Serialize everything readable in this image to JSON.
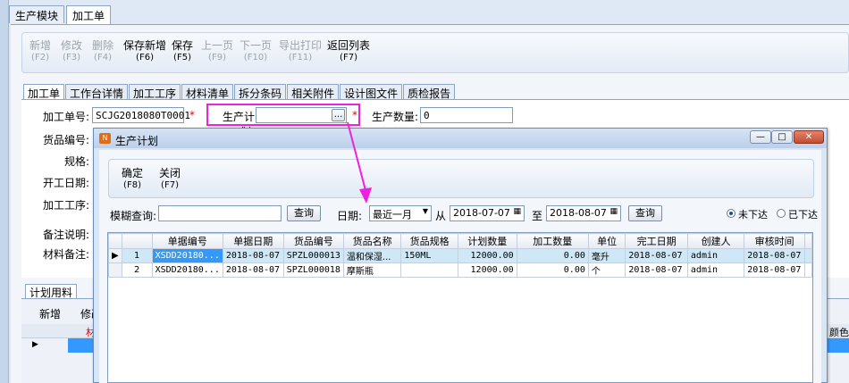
{
  "top_tabs": [
    "生产模块",
    "加工单"
  ],
  "toolbar": {
    "buttons": [
      {
        "label": "新增",
        "key": "(F2)"
      },
      {
        "label": "修改",
        "key": "(F3)"
      },
      {
        "label": "删除",
        "key": "(F4)"
      },
      {
        "label": "保存新增",
        "key": "(F6)"
      },
      {
        "label": "保存",
        "key": "(F5)"
      },
      {
        "label": "上一页",
        "key": "(F9)"
      },
      {
        "label": "下一页",
        "key": "(F10)"
      },
      {
        "label": "导出打印",
        "key": "(F11)"
      },
      {
        "label": "返回列表",
        "key": "(F7)"
      }
    ]
  },
  "subtabs": [
    "加工单",
    "工作台详情",
    "加工工序",
    "材料清单",
    "拆分条码",
    "相关附件",
    "设计图文件",
    "质检报告"
  ],
  "form": {
    "order_no_label": "加工单号:",
    "order_no_value": "SCJG2018080T0001",
    "plan_label": "生产计划:",
    "plan_browse": "...",
    "qty_label": "生产数量:",
    "qty_value": "0",
    "goods_no_label": "货品编号:",
    "spec_label": "规格:",
    "start_date_label": "开工日期:",
    "process_label": "加工工序:",
    "remark_label": "备注说明:",
    "material_remark_label": "材料备注:",
    "required_mark": "*"
  },
  "bottom": {
    "tab": "计划用料",
    "add_button": "新增",
    "modify_button": "修改",
    "column_fragment": "材",
    "color_fragment": "颜色"
  },
  "dialog": {
    "title": "生产计划",
    "confirm": {
      "label": "确定",
      "key": "(F8)"
    },
    "close": {
      "label": "关闭",
      "key": "(F7)"
    },
    "fuzzy_label": "模糊查询:",
    "query_button": "查询",
    "date_label": "日期:",
    "date_range": "最近一月",
    "from_label": "从",
    "from_date": "2018-07-07",
    "to_label": "至",
    "to_date": "2018-08-07",
    "query_button2": "查询",
    "radio_not_issued": "未下达",
    "radio_issued": "已下达",
    "columns": [
      "单据编号",
      "单据日期",
      "货品编号",
      "货品名称",
      "货品规格",
      "计划数量",
      "加工数量",
      "单位",
      "完工日期",
      "创建人",
      "审核时间"
    ],
    "rows": [
      {
        "idx": "1",
        "doc_no": "XSDD20180...",
        "date": "2018-08-07",
        "goods_no": "SPZL000013",
        "goods_name": "温和保湿...",
        "spec": "150ML",
        "plan_qty": "12000.00",
        "proc_qty": "0.00",
        "unit": "毫升",
        "finish_date": "2018-08-07",
        "creator": "admin",
        "audit_time": "2018-08-07"
      },
      {
        "idx": "2",
        "doc_no": "XSDD20180...",
        "date": "2018-08-07",
        "goods_no": "SPZL000018",
        "goods_name": "摩斯瓶",
        "spec": "",
        "plan_qty": "12000.00",
        "proc_qty": "0.00",
        "unit": "个",
        "finish_date": "2018-08-07",
        "creator": "admin",
        "audit_time": "2018-08-07"
      }
    ]
  },
  "colors": {
    "highlight": "#ee22dd",
    "selection": "#3399ff",
    "required": "#ee0000"
  }
}
